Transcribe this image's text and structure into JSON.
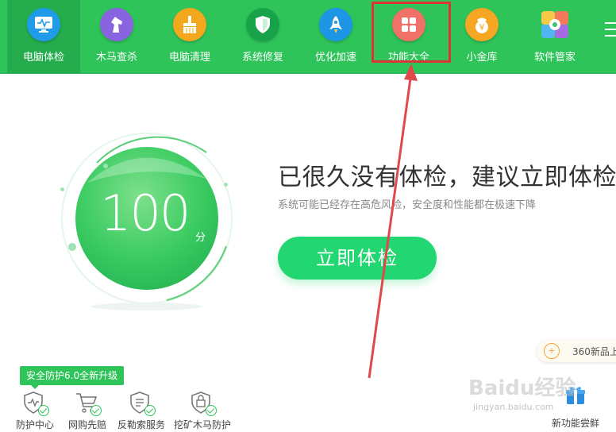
{
  "colors": {
    "brand_green": "#2fc45a",
    "button_green": "#22d671",
    "highlight_red": "#d9363a"
  },
  "nav": [
    {
      "label": "电脑体检",
      "icon": "monitor-icon",
      "active": true
    },
    {
      "label": "木马查杀",
      "icon": "horse-icon"
    },
    {
      "label": "电脑清理",
      "icon": "broom-icon"
    },
    {
      "label": "系统修复",
      "icon": "shield-icon"
    },
    {
      "label": "优化加速",
      "icon": "rocket-icon"
    },
    {
      "label": "功能大全",
      "icon": "grid-icon",
      "highlighted": true
    },
    {
      "label": "小金库",
      "icon": "coin-icon"
    },
    {
      "label": "软件管家",
      "icon": "software-icon"
    }
  ],
  "menu_icon": "hamburger-menu-icon",
  "score": {
    "value": "100",
    "unit": "分"
  },
  "main": {
    "headline": "已很久没有体检，建议立即体检！",
    "subline": "系统可能已经存在高危风险，安全度和性能都在极速下降",
    "check_button": "立即体检"
  },
  "bottom": {
    "promo_badge": "安全防护6.0全新升级",
    "items": [
      {
        "label": "防护中心",
        "icon": "shield-pulse-icon"
      },
      {
        "label": "网购先赔",
        "icon": "shopping-cart-icon"
      },
      {
        "label": "反勒索服务",
        "icon": "document-shield-icon"
      },
      {
        "label": "挖矿木马防护",
        "icon": "lock-shield-icon"
      }
    ],
    "right_promo": "360新品上",
    "new_feature": "新功能尝鲜"
  },
  "watermark": {
    "text": "Baidu经验",
    "sub": "jingyan.baidu.com"
  }
}
